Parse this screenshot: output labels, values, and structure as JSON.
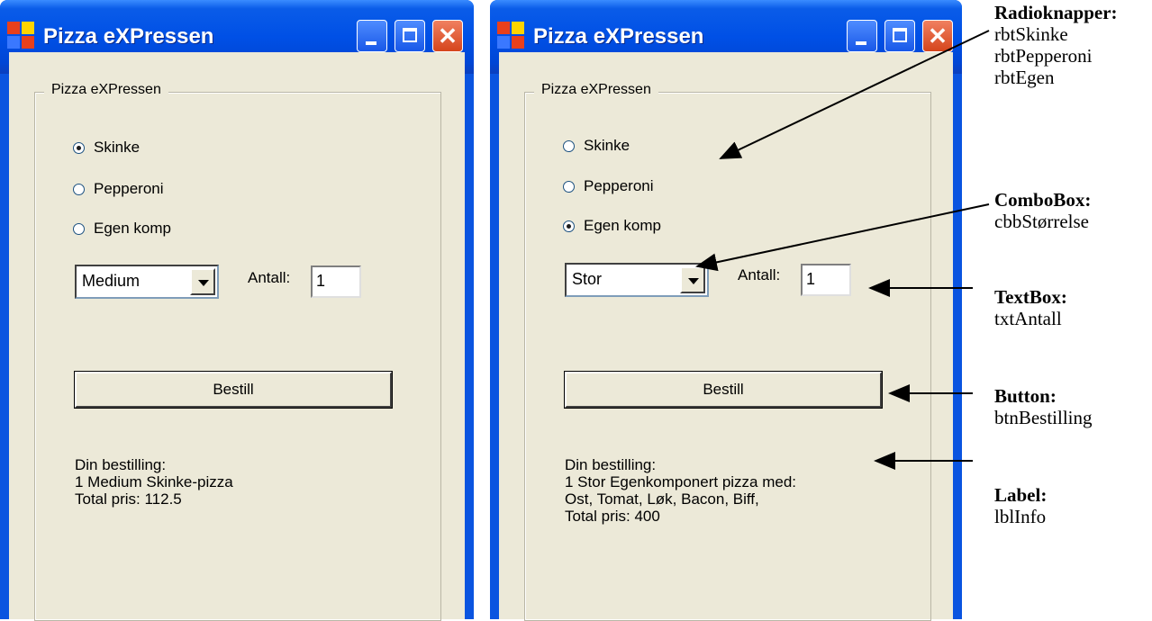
{
  "window_title": "Pizza eXPressen",
  "groupbox_title": "Pizza eXPressen",
  "left": {
    "radios": [
      {
        "label": "Skinke",
        "checked": true
      },
      {
        "label": "Pepperoni",
        "checked": false
      },
      {
        "label": "Egen komp",
        "checked": false
      }
    ],
    "combo_value": "Medium",
    "antall_label": "Antall:",
    "antall_value": "1",
    "button_label": "Bestill",
    "info_lines": [
      "Din bestilling:",
      "1 Medium Skinke-pizza",
      "Total pris: 112.5"
    ]
  },
  "right": {
    "radios": [
      {
        "label": "Skinke",
        "checked": false
      },
      {
        "label": "Pepperoni",
        "checked": false
      },
      {
        "label": "Egen komp",
        "checked": true
      }
    ],
    "combo_value": "Stor",
    "antall_label": "Antall:",
    "antall_value": "1",
    "button_label": "Bestill",
    "info_lines": [
      "Din bestilling:",
      "1 Stor Egenkomponert pizza med:",
      "Ost, Tomat, Løk, Bacon, Biff,",
      "Total pris: 400"
    ]
  },
  "annotations": [
    {
      "heading": "Radioknapper:",
      "values": [
        "rbtSkinke",
        "rbtPepperoni",
        "rbtEgen"
      ]
    },
    {
      "heading": "ComboBox:",
      "values": [
        "cbbStørrelse"
      ]
    },
    {
      "heading": "TextBox:",
      "values": [
        "txtAntall"
      ]
    },
    {
      "heading": "Button:",
      "values": [
        "btnBestilling"
      ]
    },
    {
      "heading": "Label:",
      "values": [
        "lblInfo"
      ]
    }
  ],
  "colors": {
    "titlebar": "#0054e3",
    "client": "#ece9d8",
    "close_button": "#e0603c"
  },
  "icons": [
    "app-icon",
    "minimize-icon",
    "maximize-icon",
    "close-icon"
  ]
}
